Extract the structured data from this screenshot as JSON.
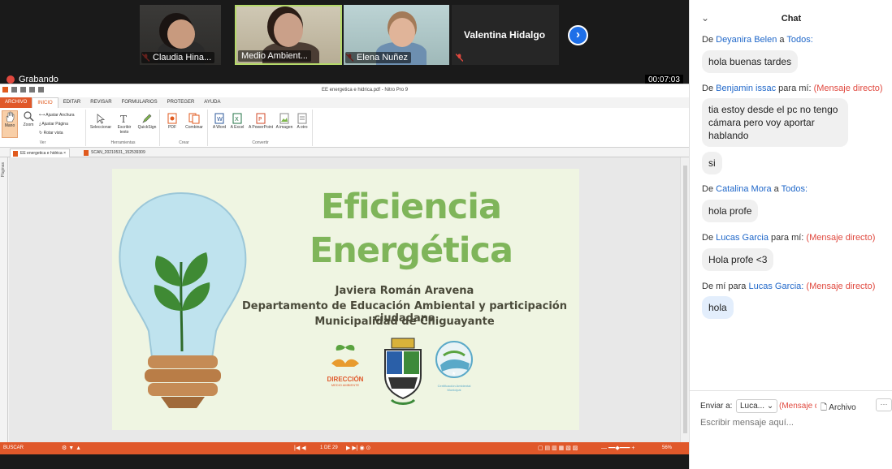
{
  "meeting": {
    "participants": [
      {
        "name": "Claudia Hina...",
        "muted": true,
        "active": false
      },
      {
        "name": "Medio Ambient...",
        "muted": false,
        "active": true
      },
      {
        "name": "Elena Nuñez",
        "muted": true,
        "active": false
      }
    ],
    "large_participant": "Valentina Hidalgo",
    "recording_label": "Grabando",
    "timer": "00:07:03"
  },
  "app": {
    "window_title": "EE energetica e hidrica.pdf - Nitro Pro 9",
    "tabs": [
      "ARCHIVO",
      "INICIO",
      "EDITAR",
      "REVISAR",
      "FORMULARIOS",
      "PROTEGER",
      "AYUDA"
    ],
    "selected_tab": "INICIO",
    "ribbon": {
      "ver": {
        "label": "Ver",
        "mano": "Mano",
        "zoom": "Zoom",
        "ajustar_anchura": "Ajustar Anchura",
        "ajustar_pagina": "Ajustar Página",
        "rotar_vista": "Rotar vista"
      },
      "herramientas": {
        "label": "Herramientas",
        "seleccionar": "Seleccionar",
        "escribir_texto": "Escribir texto",
        "quicksign": "QuickSign"
      },
      "crear": {
        "label": "Crear",
        "pdf": "PDF",
        "combinar": "Combinar"
      },
      "convertir": {
        "label": "Convertir",
        "word": "A Word",
        "excel": "A Excel",
        "powerpoint": "A PowerPoint",
        "imagen": "A imagen",
        "otro": "A otro"
      }
    },
    "doc_tabs": [
      "EE energetica e hidrica",
      "SCAN_20210531_152539309"
    ],
    "side_panel_label": "Páginas",
    "status": {
      "buscar": "BUSCAR",
      "page": "1 DE 29",
      "zoom": "56%"
    }
  },
  "slide": {
    "title_line1": "Eficiencia",
    "title_line2": "Energética",
    "author": "Javiera Román Aravena",
    "department": "Departamento de Educación Ambiental y participación ciudadana",
    "municipality": "Municipalidad de Chiguayante",
    "logo_direccion": "DIRECCIÓN",
    "logo_direccion_sub": "MEDIO AMBIENTE",
    "logo_cert": "Certificación Ambiental Municipal",
    "colors": {
      "title": "#7fb55a",
      "slide_bg": "#eff5e2"
    }
  },
  "chat": {
    "title": "Chat",
    "messages": [
      {
        "prefix": "De",
        "from": "Deyanira Belen",
        "join": "a",
        "to": "Todos:",
        "direct": "",
        "text": "hola buenas tardes",
        "mine": false
      },
      {
        "prefix": "De",
        "from": "Benjamin issac",
        "join": "para mí:",
        "to": "",
        "direct": "(Mensaje directo)",
        "text": "tia estoy desde el pc no tengo cámara pero voy aportar hablando",
        "mine": false
      },
      {
        "prefix": "",
        "from": "",
        "join": "",
        "to": "",
        "direct": "",
        "text": "si",
        "mine": false
      },
      {
        "prefix": "De",
        "from": "Catalina Mora",
        "join": "a",
        "to": "Todos:",
        "direct": "",
        "text": "hola profe",
        "mine": false
      },
      {
        "prefix": "De",
        "from": "Lucas Garcia",
        "join": "para mí:",
        "to": "",
        "direct": "(Mensaje directo)",
        "text": "Hola profe <3",
        "mine": false
      },
      {
        "prefix": "De mí para",
        "from": "Lucas Garcia:",
        "join": "",
        "to": "",
        "direct": "(Mensaje directo)",
        "text": "hola",
        "mine": true
      }
    ],
    "send_to_label": "Enviar a:",
    "recipient": "Luca...",
    "recipient_mode": "(Mensaje directo)",
    "file_label": "Archivo",
    "input_placeholder": "Escribir mensaje aquí..."
  }
}
